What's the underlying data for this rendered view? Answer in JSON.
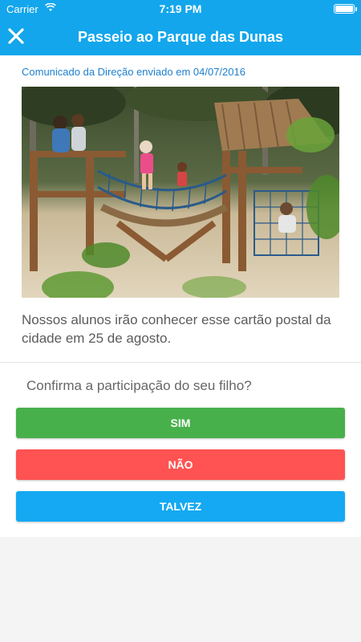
{
  "status_bar": {
    "carrier": "Carrier",
    "wifi_icon": "wifi-icon",
    "time": "7:19 PM",
    "battery_icon": "battery-icon"
  },
  "header": {
    "title": "Passeio ao Parque das Dunas",
    "close_icon": "close-icon",
    "background_color": "#13a6ec"
  },
  "message": {
    "sent_info": "Comunicado da Direção enviado em 04/07/2016",
    "body": "Nossos alunos irão conhecer esse cartão postal da cidade em 25 de agosto.",
    "image_alt": "Crianças brincando em parquinho de madeira com redes de corda"
  },
  "rsvp": {
    "question": "Confirma a participação do seu filho?",
    "yes_label": "SIM",
    "no_label": "NÃO",
    "maybe_label": "TALVEZ",
    "yes_color": "#47b04b",
    "no_color": "#ff5252",
    "maybe_color": "#14a9f2"
  }
}
